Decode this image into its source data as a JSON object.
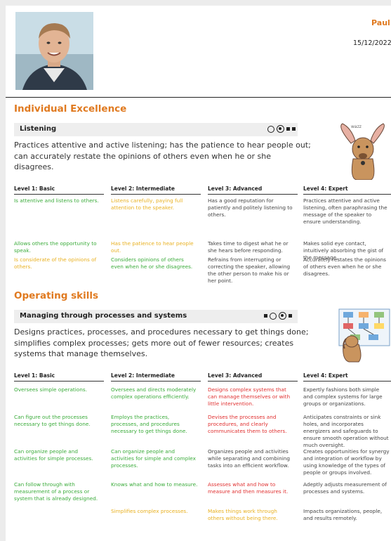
{
  "header": {
    "name": "Paul",
    "date": "15/12/2022"
  },
  "colors": {
    "accent": "#e07a20",
    "met": "#3aab3a",
    "partial": "#e8b020",
    "gap": "#e03030",
    "neutral": "#444444"
  },
  "sections": [
    {
      "title": "Individual Excellence",
      "competency": {
        "title": "Listening",
        "rating_icons": [
          "ring",
          "ring-dot",
          "square",
          "square"
        ],
        "description": "Practices attentive and active listening; has the patience to hear people out; can accurately restate the opinions of others even when he or she disagrees.",
        "illustration": "dog-with-big-ears",
        "levels": [
          "Level 1: Basic",
          "Level 2: Intermediate",
          "Level 3: Advanced",
          "Level 4: Expert"
        ],
        "rows": [
          [
            {
              "text": "Is attentive and listens to others.",
              "status": "green"
            },
            {
              "text": "Listens carefully, paying full attention to the speaker.",
              "status": "yellow"
            },
            {
              "text": "Has a good reputation for patiently and politely listening to others.",
              "status": "grey"
            },
            {
              "text": "Practices attentive and active listening, often paraphrasing the message of the speaker to ensure understanding.",
              "status": "grey"
            }
          ],
          [
            {
              "text": "Allows others the opportunity to speak.",
              "status": "green"
            },
            {
              "text": "Has the patience to hear people out.",
              "status": "yellow"
            },
            {
              "text": "Takes time to digest what he or she hears before responding.",
              "status": "grey"
            },
            {
              "text": "Makes solid eye contact, intuitively absorbing the gist of the message.",
              "status": "grey"
            }
          ],
          [
            {
              "text": "Is considerate of the opinions of others.",
              "status": "yellow"
            },
            {
              "text": "Considers opinions of others even when he or she disagrees.",
              "status": "green"
            },
            {
              "text": "Refrains from interrupting or correcting the speaker, allowing the other person to make his or her point.",
              "status": "grey"
            },
            {
              "text": "Accurately restates the opinions of others even when he or she disagrees.",
              "status": "grey"
            }
          ]
        ]
      }
    },
    {
      "title": "Operating skills",
      "competency": {
        "title": "Managing through processes and systems",
        "rating_icons": [
          "square",
          "ring",
          "ring-dot",
          "square"
        ],
        "description": "Designs practices, processes, and procedures necessary to get things done; simplifies complex processes; gets more out of fewer resources; creates systems that manage themselves.",
        "illustration": "dog-with-flowchart",
        "levels": [
          "Level 1: Basic",
          "Level 2: Intermediate",
          "Level 3: Advanced",
          "Level 4: Expert"
        ],
        "rows": [
          [
            {
              "text": "Oversees simple operations.",
              "status": "green"
            },
            {
              "text": "Oversees and directs moderately complex operations efficiently.",
              "status": "green"
            },
            {
              "text": "Designs complex systems that can manage themselves or with little intervention.",
              "status": "red"
            },
            {
              "text": "Expertly fashions both simple and complex systems for large groups or organizations.",
              "status": "grey"
            }
          ],
          [
            {
              "text": "Can figure out the processes necessary to get things done.",
              "status": "green"
            },
            {
              "text": "Employs the practices, processes, and procedures necessary to get things done.",
              "status": "green"
            },
            {
              "text": "Devises the processes and procedures, and clearly communicates them to others.",
              "status": "red"
            },
            {
              "text": "Anticipates constraints or sink holes, and incorporates energizers and safeguards to ensure smooth operation without much oversight.",
              "status": "grey"
            }
          ],
          [
            {
              "text": "Can organize people and activities for simple processes.",
              "status": "green"
            },
            {
              "text": "Can organize people and activities for simple and complex processes.",
              "status": "green"
            },
            {
              "text": "Organizes people and activities while separating and combining tasks into an efficient workflow.",
              "status": "grey"
            },
            {
              "text": "Creates opportunities for synergy and integration of workflow by using knowledge of the types of people or groups involved.",
              "status": "grey"
            }
          ],
          [
            {
              "text": "Can follow through with measurement of a process or system that is already designed.",
              "status": "green"
            },
            {
              "text": "Knows what and how to measure.",
              "status": "green"
            },
            {
              "text": "Assesses what and how to measure and then measures it.",
              "status": "red"
            },
            {
              "text": "Adeptly adjusts measurement of processes and systems.",
              "status": "grey"
            }
          ],
          [
            {
              "text": "",
              "status": "grey"
            },
            {
              "text": "Simplifies complex processes.",
              "status": "yellow"
            },
            {
              "text": "Makes things work through others without being there.",
              "status": "yellow"
            },
            {
              "text": "Impacts organizations, people, and results remotely.",
              "status": "grey"
            }
          ]
        ]
      }
    }
  ]
}
